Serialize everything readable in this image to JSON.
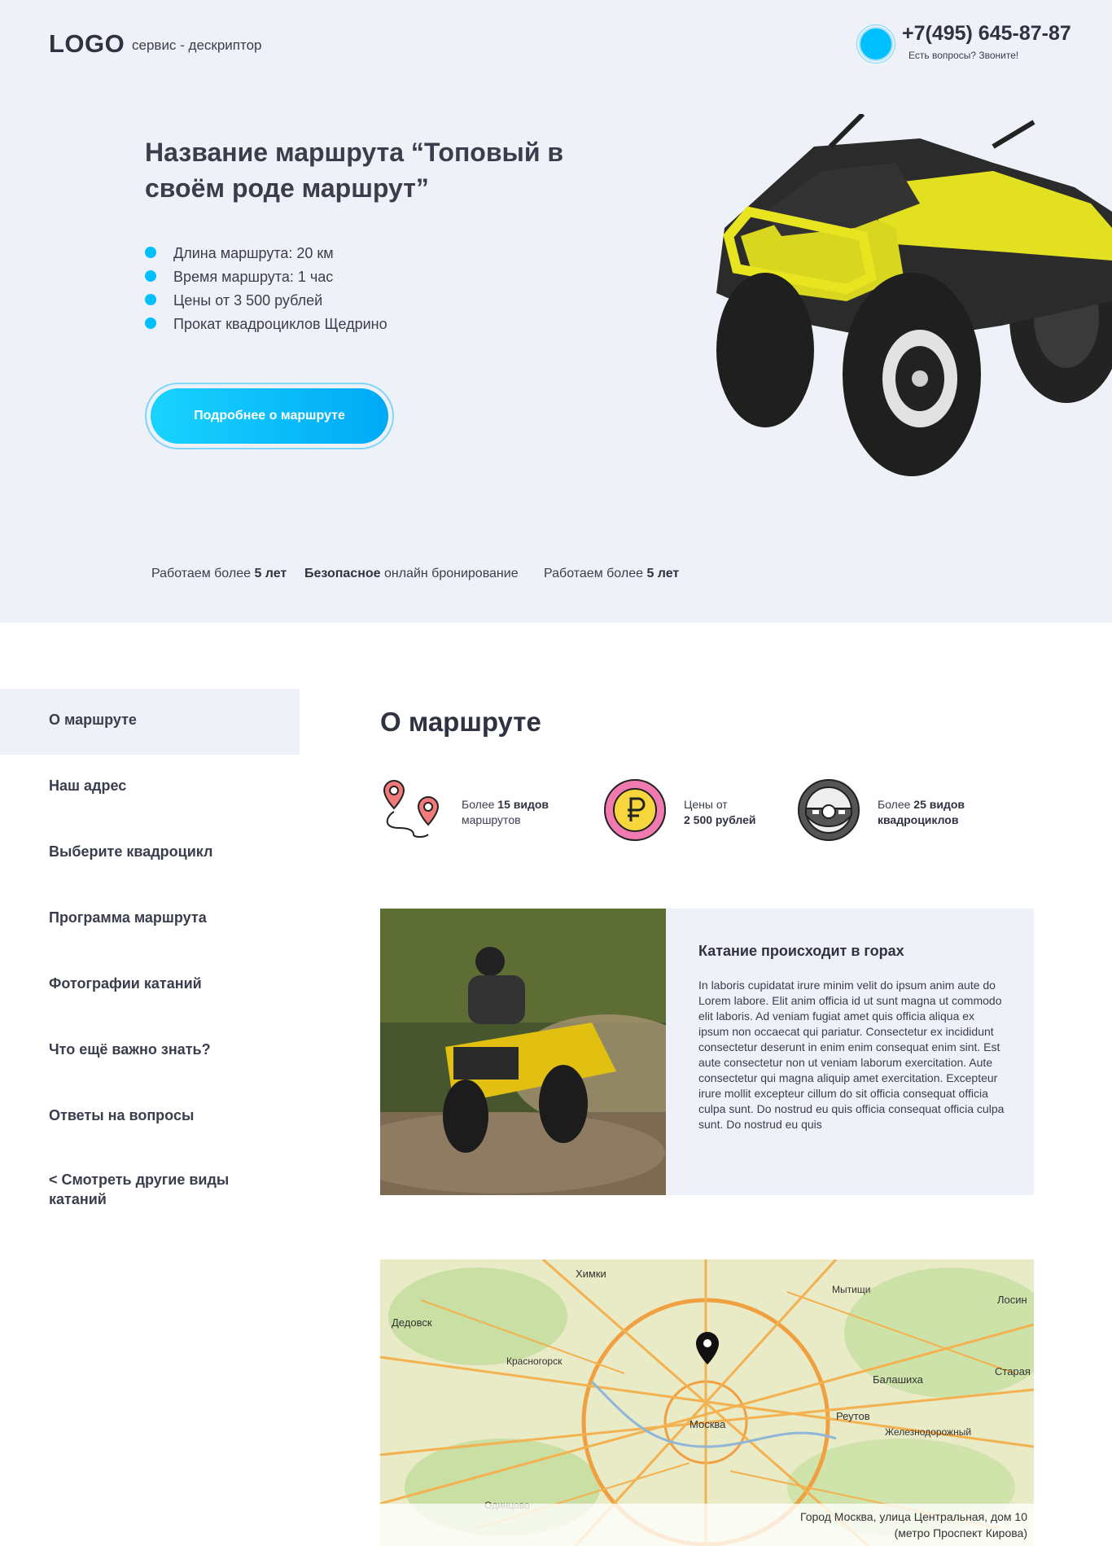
{
  "header": {
    "logo": "LOGO",
    "descriptor": "сервис - дескриптор",
    "phone": "+7(495) 645-87-87",
    "phone_caption": "Есть вопросы? Звоните!"
  },
  "hero": {
    "title": "Название маршрута “Топовый в своём роде маршрут”",
    "features": [
      "Длина маршрута: 20 км",
      "Время маршрута: 1 час",
      "Цены от 3 500 рублей",
      "Прокат квадроциклов Щедрино"
    ],
    "cta_label": "Подробнее о маршруте",
    "stats": [
      {
        "prefix": "Работаем более ",
        "bold": "5 лет",
        "suffix": ""
      },
      {
        "prefix": "",
        "bold": "Безопасное",
        "suffix": " онлайн бронирование"
      },
      {
        "prefix": "Работаем более ",
        "bold": "5 лет",
        "suffix": ""
      }
    ]
  },
  "sidebar": {
    "items": [
      "О маршруте",
      "Наш адрес",
      "Выберите квадроцикл",
      "Программа маршрута",
      "Фотографии катаний",
      "Что ещё важно знать?",
      "Ответы на вопросы",
      "< Смотреть другие виды катаний"
    ]
  },
  "main": {
    "title": "О маршруте",
    "info": [
      {
        "icon": "route-pins-icon",
        "line1_prefix": "Более ",
        "line1_bold": "15 видов",
        "line2": "маршрутов",
        "line2_bold": false
      },
      {
        "icon": "ruble-coin-icon",
        "line1_prefix": "Цены от",
        "line1_bold": "",
        "line2": "2 500 рублей",
        "line2_bold": true
      },
      {
        "icon": "steering-wheel-icon",
        "line1_prefix": "Более ",
        "line1_bold": "25 видов",
        "line2": "квадроциклов",
        "line2_bold": true
      }
    ],
    "card": {
      "title": "Катание происходит в горах",
      "text": "In laboris cupidatat irure minim velit do ipsum anim aute do Lorem labore. Elit anim officia id ut sunt magna ut commodo elit laboris. Ad veniam fugiat amet quis officia aliqua ex ipsum non occaecat qui pariatur. Consectetur ex incididunt consectetur deserunt in enim enim consequat enim sint. Est aute consectetur non ut veniam laborum exercitation. Aute consectetur qui magna aliquip amet exercitation. Excepteur irure mollit excepteur cillum do sit officia consequat officia culpa sunt. Do nostrud eu quis officia consequat officia culpa sunt. Do nostrud eu quis"
    },
    "map": {
      "labels": [
        "Химки",
        "Дедовск",
        "Красногорск",
        "Москва",
        "Балашиха",
        "Реутов",
        "Железнодорожный",
        "Старая",
        "Лосин",
        "Одинцово",
        "Мытищи"
      ],
      "address_line1": "Город Москва, улица Центральная, дом 10",
      "address_line2": "(метро Проспект Кирова)"
    }
  },
  "colors": {
    "accent": "#00bfff",
    "hero_bg": "#eef1f8",
    "text": "#2f3341"
  }
}
